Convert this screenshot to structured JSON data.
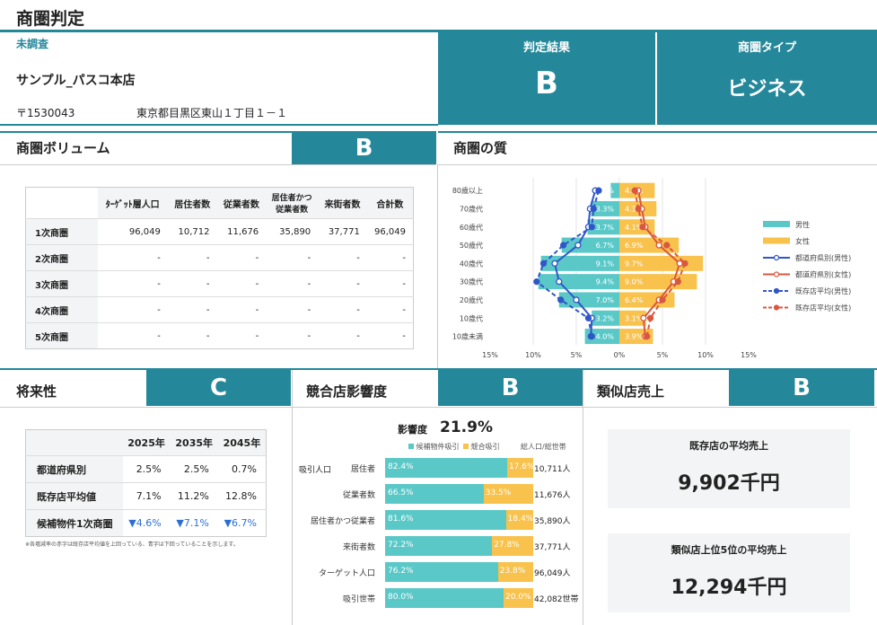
{
  "page_title": "商圏判定",
  "store": {
    "status": "未調査",
    "name": "サンプル_パスコ本店",
    "postal": "〒1530043",
    "address": "東京都目黒区東山１丁目１－１"
  },
  "result": {
    "label": "判定結果",
    "grade": "B"
  },
  "type": {
    "label": "商圏タイプ",
    "value": "ビジネス"
  },
  "volume": {
    "title": "商圏ボリューム",
    "grade": "B",
    "headers": [
      "ﾀｰｹﾞｯﾄ層人口",
      "居住者数",
      "従業者数",
      "居住者かつ従業者数",
      "来街者数",
      "合計数"
    ],
    "rows": [
      {
        "name": "1次商圏",
        "values": [
          "96,049",
          "10,712",
          "11,676",
          "35,890",
          "37,771",
          "96,049"
        ]
      },
      {
        "name": "2次商圏",
        "values": [
          "-",
          "-",
          "-",
          "-",
          "-",
          "-"
        ]
      },
      {
        "name": "3次商圏",
        "values": [
          "-",
          "-",
          "-",
          "-",
          "-",
          "-"
        ]
      },
      {
        "name": "4次商圏",
        "values": [
          "-",
          "-",
          "-",
          "-",
          "-",
          "-"
        ]
      },
      {
        "name": "5次商圏",
        "values": [
          "-",
          "-",
          "-",
          "-",
          "-",
          "-"
        ]
      }
    ]
  },
  "quality": {
    "title": "商圏の質",
    "chart_data": {
      "type": "bar",
      "orientation": "population-pyramid",
      "categories": [
        "80歳以上",
        "70歳代",
        "60歳代",
        "50歳代",
        "40歳代",
        "30歳代",
        "20歳代",
        "10歳代",
        "10歳未満"
      ],
      "x_ticks": [
        "15%",
        "10%",
        "5%",
        "0%",
        "5%",
        "10%",
        "15%"
      ],
      "xlim": [
        -15,
        15
      ],
      "series": [
        {
          "name": "男性",
          "color": "#5bc8c8",
          "values": [
            1.0,
            3.3,
            3.7,
            6.7,
            9.1,
            9.4,
            7.0,
            3.2,
            4.0
          ],
          "labels": [
            "0%",
            "3.3%",
            "3.7%",
            "6.7%",
            "9.1%",
            "9.4%",
            "7.0%",
            "3.2%",
            "4.0%"
          ]
        },
        {
          "name": "女性",
          "color": "#f8c24c",
          "values": [
            4.1,
            4.3,
            4.1,
            6.9,
            9.7,
            9.0,
            6.4,
            3.1,
            3.9
          ],
          "labels": [
            "4.1%",
            "4.3%",
            "4.1%",
            "6.9%",
            "9.7%",
            "9.0%",
            "6.4%",
            "3.1%",
            "3.9%"
          ]
        },
        {
          "name": "都道府県別(男性)",
          "color": "#3056c8",
          "style": "solid-open",
          "values": [
            2.8,
            3.4,
            3.6,
            4.8,
            7.5,
            7.0,
            5.0,
            3.2,
            3.3
          ]
        },
        {
          "name": "都道府県別(女性)",
          "color": "#d9573f",
          "style": "solid-open",
          "values": [
            2.2,
            2.6,
            3.0,
            4.6,
            7.0,
            6.3,
            4.6,
            2.8,
            3.0
          ]
        },
        {
          "name": "既存店平均(男性)",
          "color": "#3056c8",
          "style": "dashed-filled",
          "values": [
            2.4,
            3.0,
            3.2,
            6.5,
            8.8,
            9.6,
            6.8,
            3.6,
            3.2
          ]
        },
        {
          "name": "既存店平均(女性)",
          "color": "#d9573f",
          "style": "dashed-filled",
          "values": [
            1.8,
            2.2,
            2.7,
            5.5,
            7.6,
            6.8,
            5.0,
            3.6,
            3.2
          ]
        }
      ]
    }
  },
  "future": {
    "title": "将来性",
    "grade": "C",
    "headers": [
      "",
      "2025年",
      "2035年",
      "2045年"
    ],
    "rows": [
      {
        "name": "都道府県別",
        "values": [
          "2.5%",
          "2.5%",
          "0.7%"
        ]
      },
      {
        "name": "既存店平均値",
        "values": [
          "7.1%",
          "11.2%",
          "12.8%"
        ]
      },
      {
        "name": "候補物件1次商圏",
        "values": [
          "▼4.6%",
          "▼7.1%",
          "▼6.7%"
        ]
      }
    ],
    "note": "※各増減率の赤字は既存店平均値を上回っている、青字は下回っていることを示します。"
  },
  "competition": {
    "title": "競合店影響度",
    "grade": "B",
    "impact_label": "影響度",
    "impact_value": "21.9%",
    "legend": [
      "候補物件吸引",
      "競合吸引"
    ],
    "count_header": "総人口/総世帯",
    "group_label": "吸引人口",
    "chart_data": {
      "type": "bar",
      "orientation": "stacked-100",
      "categories": [
        "居住者",
        "従業者数",
        "居住者かつ従業者",
        "来街者数",
        "ターゲット人口",
        "吸引世帯"
      ],
      "series": [
        {
          "name": "候補物件吸引",
          "color": "#5bc8c8",
          "values": [
            82.4,
            66.5,
            81.6,
            72.2,
            76.2,
            80.0
          ]
        },
        {
          "name": "競合吸引",
          "color": "#f8c24c",
          "values": [
            17.6,
            33.5,
            18.4,
            27.8,
            23.8,
            20.0
          ]
        }
      ],
      "counts": [
        "10,711人",
        "11,676人",
        "35,890人",
        "37,771人",
        "96,049人",
        "42,082世帯"
      ]
    }
  },
  "similar": {
    "title": "類似店売上",
    "grade": "B",
    "cards": [
      {
        "label": "既存店の平均売上",
        "value": "9,902千円"
      },
      {
        "label": "類似店上位5位の平均売上",
        "value": "12,294千円"
      }
    ]
  }
}
